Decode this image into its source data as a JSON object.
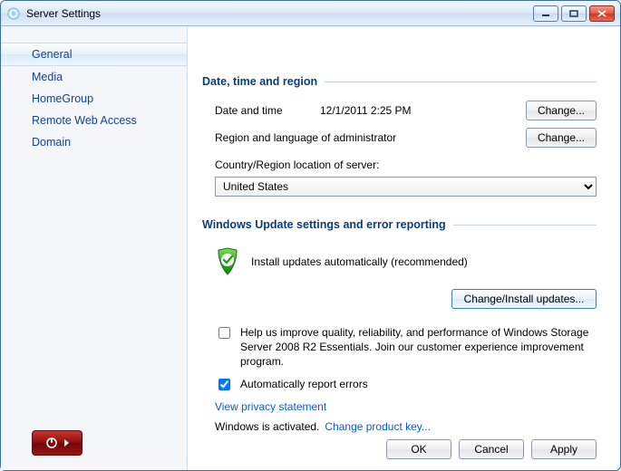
{
  "window": {
    "title": "Server Settings"
  },
  "sidebar": {
    "items": [
      {
        "label": "General",
        "selected": true
      },
      {
        "label": "Media",
        "selected": false
      },
      {
        "label": "HomeGroup",
        "selected": false
      },
      {
        "label": "Remote Web Access",
        "selected": false
      },
      {
        "label": "Domain",
        "selected": false
      }
    ]
  },
  "sections": {
    "dateRegion": {
      "title": "Date, time and region",
      "dateLabel": "Date and time",
      "dateValue": "12/1/2011 2:25 PM",
      "changeBtn": "Change...",
      "regionLabel": "Region and language of administrator",
      "countryLabel": "Country/Region location of server:",
      "countryValue": "United States"
    },
    "updates": {
      "title": "Windows Update settings and error reporting",
      "autoInstall": "Install updates automatically (recommended)",
      "changeInstallBtn": "Change/Install updates...",
      "helpChk": "Help us improve quality, reliability, and performance of Windows Storage Server 2008 R2 Essentials. Join our customer experience improvement program.",
      "helpChecked": false,
      "autoReport": "Automatically report errors",
      "autoReportChecked": true,
      "privacyLink": "View privacy statement",
      "activationStatus": "Windows is activated.",
      "productKeyLink": "Change product key..."
    }
  },
  "footer": {
    "ok": "OK",
    "cancel": "Cancel",
    "apply": "Apply"
  }
}
